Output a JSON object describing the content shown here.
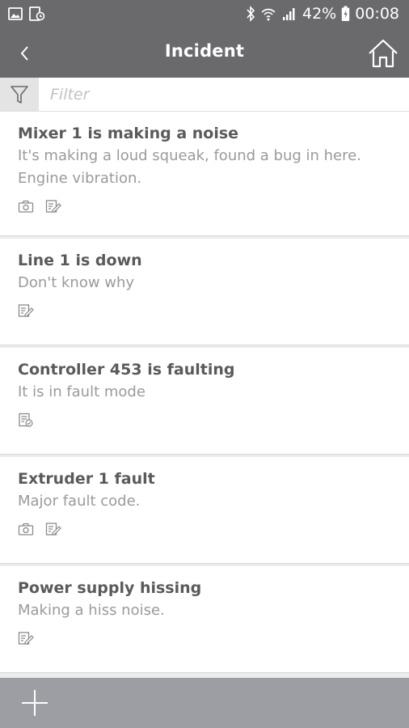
{
  "status_bar": {
    "battery": "42%",
    "time": "00:08"
  },
  "app_bar": {
    "title": "Incident"
  },
  "filter": {
    "placeholder": "Filter",
    "value": ""
  },
  "incidents": [
    {
      "title": "Mixer 1 is making a noise",
      "description": "It's making a loud squeak, found a bug in here. Engine vibration.",
      "icons": [
        "camera-icon",
        "edit-note-icon"
      ]
    },
    {
      "title": "Line 1 is down",
      "description": "Don't know why",
      "icons": [
        "edit-note-icon"
      ]
    },
    {
      "title": "Controller 453 is faulting",
      "description": "It is in fault mode",
      "icons": [
        "checklist-icon"
      ]
    },
    {
      "title": "Extruder 1 fault",
      "description": "Major fault code.",
      "icons": [
        "camera-icon",
        "edit-note-icon"
      ]
    },
    {
      "title": "Power supply hissing",
      "description": "Making a hiss noise.",
      "icons": [
        "edit-note-icon"
      ]
    }
  ]
}
